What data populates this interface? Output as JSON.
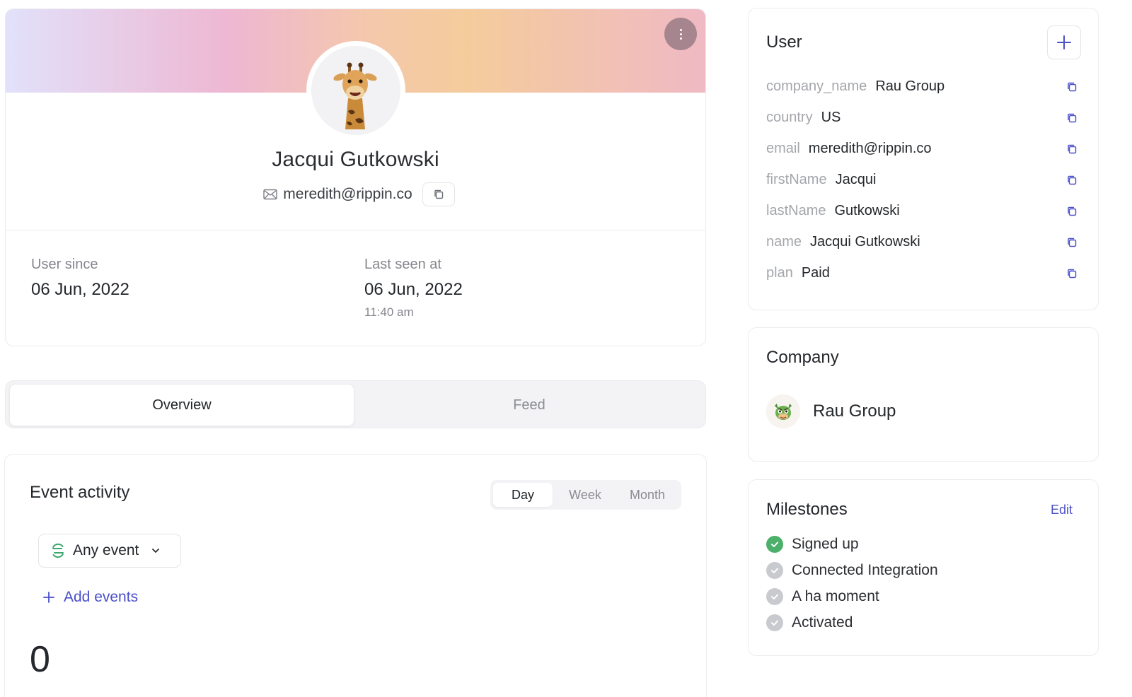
{
  "profile": {
    "name": "Jacqui Gutkowski",
    "email": "meredith@rippin.co",
    "user_since_label": "User since",
    "user_since_value": "06 Jun, 2022",
    "last_seen_label": "Last seen at",
    "last_seen_date": "06 Jun, 2022",
    "last_seen_time": "11:40 am"
  },
  "tabs": [
    {
      "label": "Overview",
      "active": true
    },
    {
      "label": "Feed",
      "active": false
    }
  ],
  "event_activity": {
    "title": "Event activity",
    "ranges": [
      "Day",
      "Week",
      "Month"
    ],
    "selected_range": "Day",
    "event_filter": "Any event",
    "add_events_label": "Add events",
    "count": "0"
  },
  "user_panel": {
    "title": "User",
    "properties": [
      {
        "key": "company_name",
        "value": "Rau Group"
      },
      {
        "key": "country",
        "value": "US"
      },
      {
        "key": "email",
        "value": "meredith@rippin.co"
      },
      {
        "key": "firstName",
        "value": "Jacqui"
      },
      {
        "key": "lastName",
        "value": "Gutkowski"
      },
      {
        "key": "name",
        "value": "Jacqui Gutkowski"
      },
      {
        "key": "plan",
        "value": "Paid"
      }
    ]
  },
  "company_panel": {
    "title": "Company",
    "company_name": "Rau Group"
  },
  "milestones_panel": {
    "title": "Milestones",
    "edit_label": "Edit",
    "items": [
      {
        "label": "Signed up",
        "done": true
      },
      {
        "label": "Connected Integration",
        "done": false
      },
      {
        "label": "A ha moment",
        "done": false
      },
      {
        "label": "Activated",
        "done": false
      }
    ]
  },
  "colors": {
    "accent": "#4a4fc7",
    "done": "#4caf6a",
    "pending": "#c9cacf"
  }
}
